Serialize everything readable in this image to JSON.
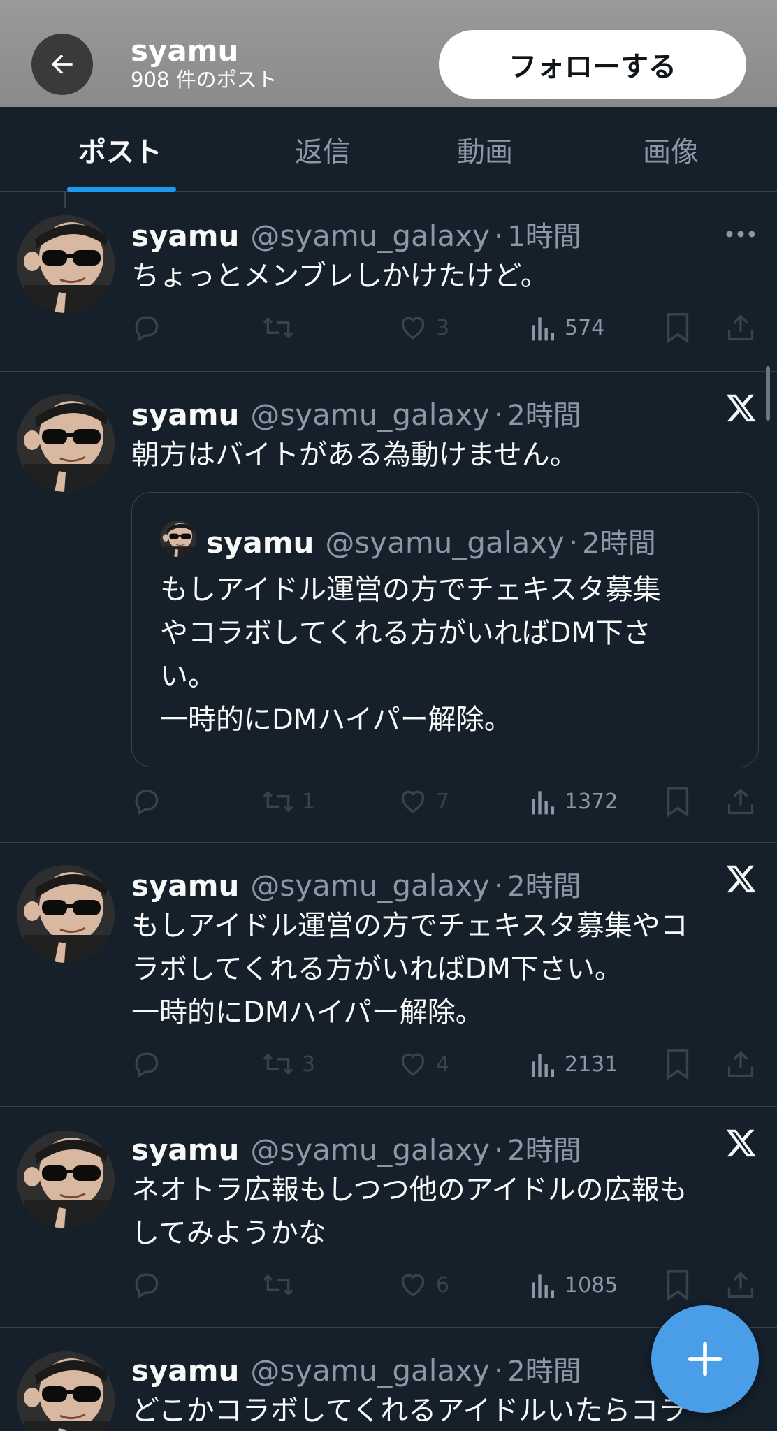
{
  "header": {
    "name": "syamu",
    "post_count": "908 件のポスト",
    "follow_label": "フォローする"
  },
  "tabs": [
    {
      "label": "ポスト",
      "active": true
    },
    {
      "label": "返信",
      "active": false
    },
    {
      "label": "動画",
      "active": false
    },
    {
      "label": "画像",
      "active": false
    }
  ],
  "posts": [
    {
      "name": "syamu",
      "handle": "@syamu_galaxy",
      "time": "1時間",
      "text": "ちょっとメンブレしかけたけど。",
      "replies": "",
      "reposts": "",
      "likes": "3",
      "views": "574"
    },
    {
      "name": "syamu",
      "handle": "@syamu_galaxy",
      "time": "2時間",
      "text": "朝方はバイトがある為動けません。",
      "quote": {
        "name": "syamu",
        "handle": "@syamu_galaxy",
        "time": "2時間",
        "text": "もしアイドル運営の方でチェキスタ募集\nやコラボしてくれる方がいればDM下さ\nい。\n一時的にDMハイパー解除。"
      },
      "replies": "",
      "reposts": "1",
      "likes": "7",
      "views": "1372"
    },
    {
      "name": "syamu",
      "handle": "@syamu_galaxy",
      "time": "2時間",
      "text": "もしアイドル運営の方でチェキスタ募集やコ\nラボしてくれる方がいればDM下さい。\n一時的にDMハイパー解除。",
      "replies": "",
      "reposts": "3",
      "likes": "4",
      "views": "2131"
    },
    {
      "name": "syamu",
      "handle": "@syamu_galaxy",
      "time": "2時間",
      "text": "ネオトラ広報もしつつ他のアイドルの広報も\nしてみようかな",
      "replies": "",
      "reposts": "",
      "likes": "6",
      "views": "1085"
    },
    {
      "name": "syamu",
      "handle": "@syamu_galaxy",
      "time": "2時間",
      "text": "どこかコラボしてくれるアイドルいたらコラ"
    }
  ],
  "dot": "·",
  "colors": {
    "accent": "#1d9bf0",
    "background": "#15202b",
    "fab": "#4a9ee8"
  },
  "icons": [
    "back-arrow-icon",
    "more-icon",
    "x-logo-icon",
    "reply-icon",
    "repost-icon",
    "like-icon",
    "views-icon",
    "bookmark-icon",
    "share-icon",
    "plus-icon"
  ]
}
